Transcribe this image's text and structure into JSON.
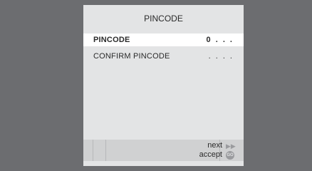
{
  "dialog": {
    "title": "PINCODE",
    "fields": [
      {
        "label": "PINCODE",
        "value": "0 . . ."
      },
      {
        "label": "CONFIRM  PINCODE",
        "value": ". . . ."
      }
    ]
  },
  "footer": {
    "next_label": "next",
    "accept_label": "accept",
    "next_icon": "fast-forward-icon",
    "accept_icon": "go-icon",
    "go_text": "GO"
  }
}
